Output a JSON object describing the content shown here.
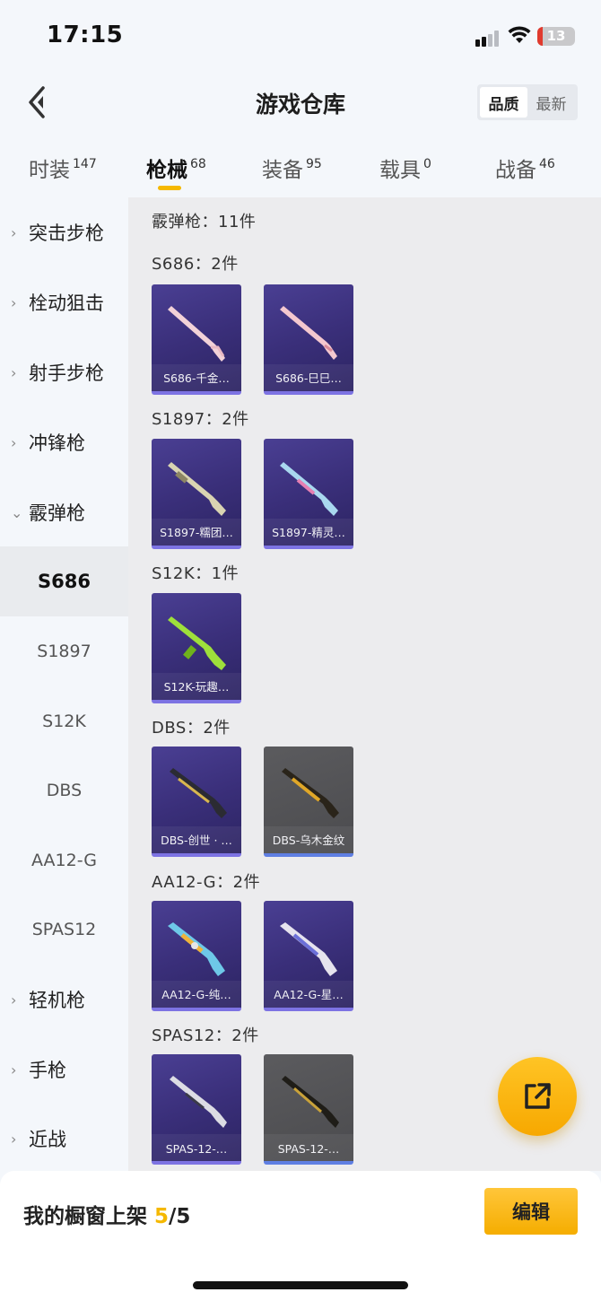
{
  "status": {
    "time": "17:15",
    "battery": "13"
  },
  "header": {
    "title": "游戏仓库",
    "sort_options": [
      "品质",
      "最新"
    ],
    "sort_active": "品质"
  },
  "tabs": [
    {
      "label": "时装",
      "count": "147"
    },
    {
      "label": "枪械",
      "count": "68"
    },
    {
      "label": "装备",
      "count": "95"
    },
    {
      "label": "载具",
      "count": "0"
    },
    {
      "label": "战备",
      "count": "46"
    }
  ],
  "active_tab": "枪械",
  "sidebar": {
    "items": [
      {
        "label": "突击步枪"
      },
      {
        "label": "栓动狙击"
      },
      {
        "label": "射手步枪"
      },
      {
        "label": "冲锋枪"
      },
      {
        "label": "霰弹枪"
      },
      {
        "label": "S686"
      },
      {
        "label": "S1897"
      },
      {
        "label": "S12K"
      },
      {
        "label": "DBS"
      },
      {
        "label": "AA12-G"
      },
      {
        "label": "SPAS12"
      },
      {
        "label": "轻机枪"
      },
      {
        "label": "手枪"
      },
      {
        "label": "近战"
      }
    ],
    "active": "S686"
  },
  "main": {
    "category_header": "霰弹枪：11件",
    "sections": [
      {
        "title": "S686：2件",
        "items": [
          {
            "name": "S686-千金…"
          },
          {
            "name": "S686-巳巳…"
          }
        ]
      },
      {
        "title": "S1897：2件",
        "items": [
          {
            "name": "S1897-糯团…"
          },
          {
            "name": "S1897-精灵…"
          }
        ]
      },
      {
        "title": "S12K：1件",
        "items": [
          {
            "name": "S12K-玩趣…"
          }
        ]
      },
      {
        "title": "DBS：2件",
        "items": [
          {
            "name": "DBS-创世 · …"
          },
          {
            "name": "DBS-乌木金纹"
          }
        ]
      },
      {
        "title": "AA12-G：2件",
        "items": [
          {
            "name": "AA12-G-纯…"
          },
          {
            "name": "AA12-G-星…"
          }
        ]
      },
      {
        "title": "SPAS12：2件",
        "items": [
          {
            "name": "SPAS-12-…"
          },
          {
            "name": "SPAS-12-…"
          }
        ]
      }
    ]
  },
  "bottom": {
    "label": "我的橱窗上架",
    "count_current": "5",
    "count_total": "/5",
    "edit": "编辑"
  },
  "colors": {
    "accent": "#f5b800",
    "card_purple": "#3a2f7a",
    "card_gray": "#4b4b4e"
  }
}
